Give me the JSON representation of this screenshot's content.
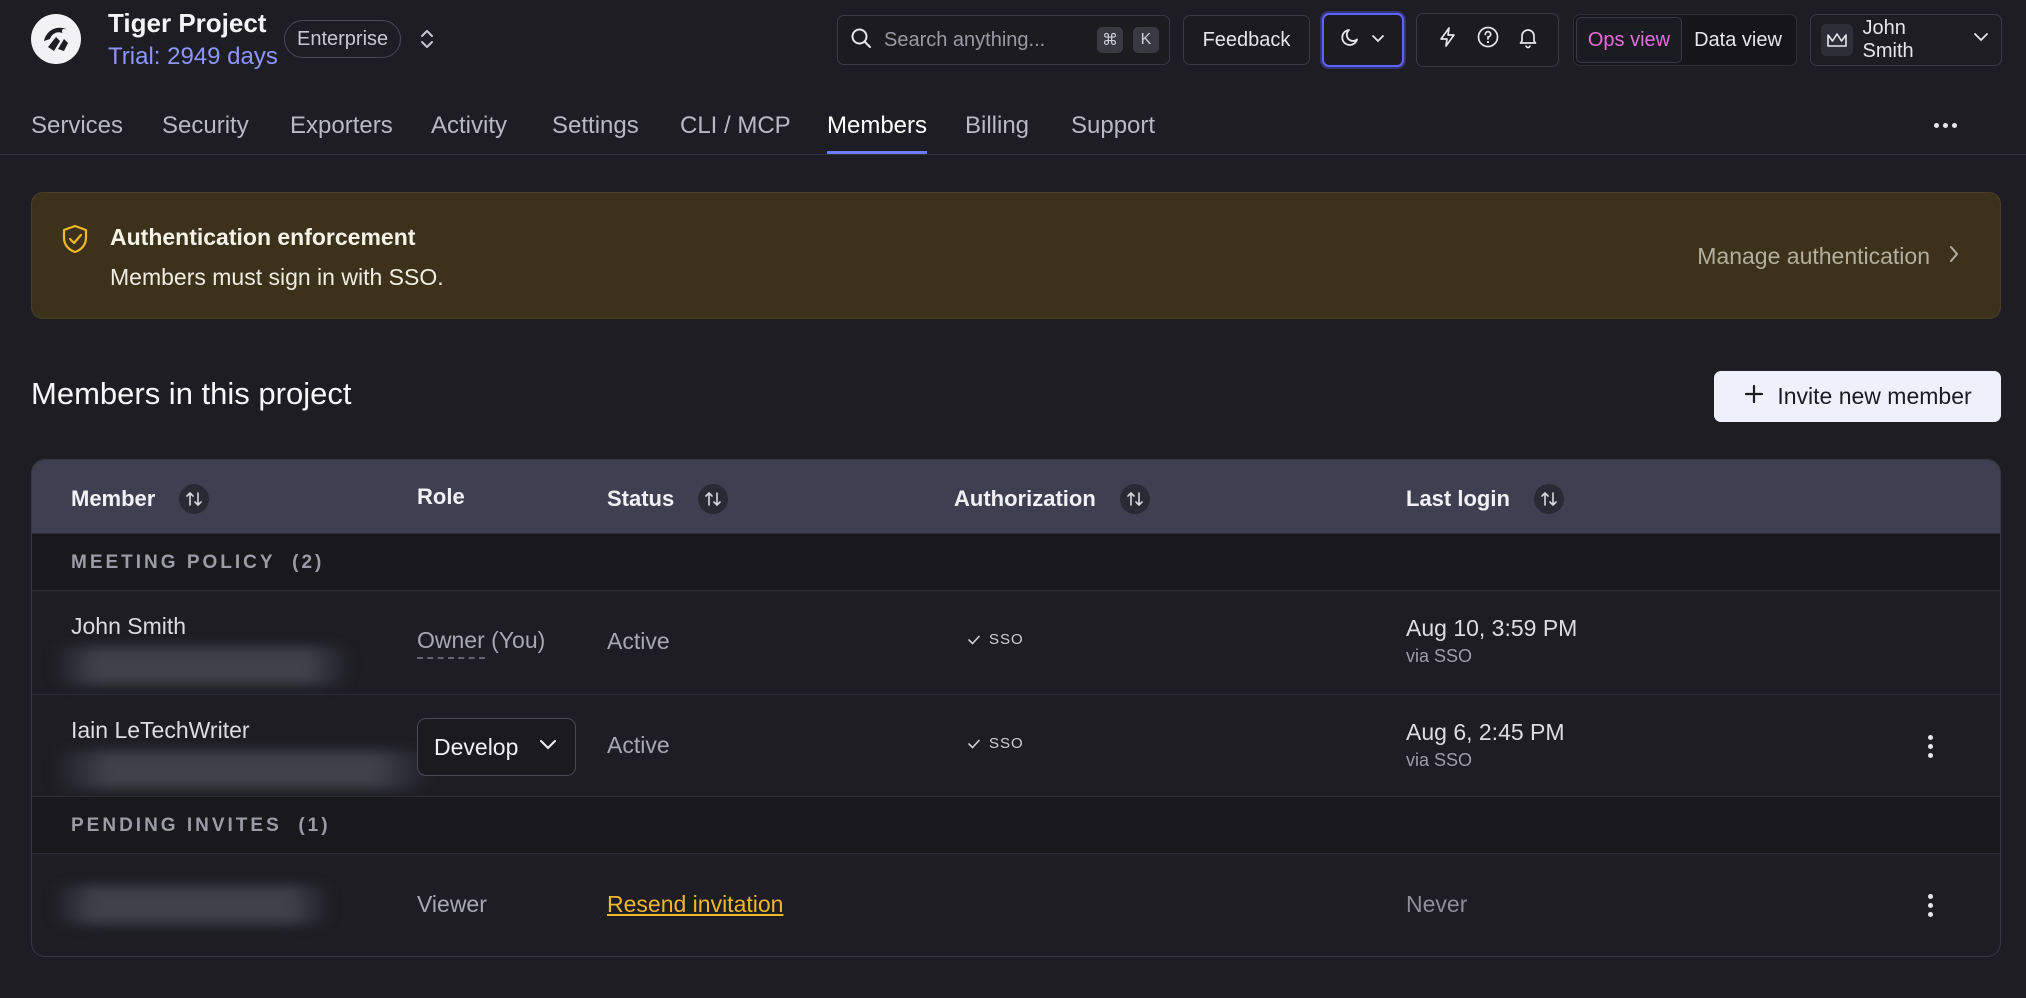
{
  "project": {
    "title": "Tiger Project",
    "trial": "Trial: 2949 days",
    "plan": "Enterprise"
  },
  "search": {
    "placeholder": "Search anything...",
    "kbd_mod": "⌘",
    "kbd_key": "K"
  },
  "toolbar": {
    "feedback_label": "Feedback",
    "view_ops": "Ops view",
    "view_data": "Data view",
    "active_view": "Ops view",
    "user_name": "John Smith"
  },
  "tabs": [
    {
      "label": "Services"
    },
    {
      "label": "Security"
    },
    {
      "label": "Exporters"
    },
    {
      "label": "Activity"
    },
    {
      "label": "Settings"
    },
    {
      "label": "CLI / MCP"
    },
    {
      "label": "Members"
    },
    {
      "label": "Billing"
    },
    {
      "label": "Support"
    }
  ],
  "active_tab": "Members",
  "banner": {
    "title": "Authentication enforcement",
    "text": "Members must sign in with SSO.",
    "link": "Manage authentication"
  },
  "section": {
    "title": "Members in this project",
    "invite_label": "Invite new member"
  },
  "table": {
    "columns": {
      "member": "Member",
      "role": "Role",
      "status": "Status",
      "authorization": "Authorization",
      "last_login": "Last login"
    },
    "groups": [
      {
        "label": "MEETING POLICY",
        "count": "(2)",
        "rows": [
          {
            "name": "John Smith",
            "role": "Owner",
            "role_suffix": "(You)",
            "status": "Active",
            "auth": "SSO",
            "last_login": "Aug 10, 3:59 PM",
            "login_via": "via SSO"
          },
          {
            "name": "Iain LeTechWriter",
            "role": "Develop",
            "status": "Active",
            "auth": "SSO",
            "last_login": "Aug 6, 2:45 PM",
            "login_via": "via SSO"
          }
        ]
      },
      {
        "label": "PENDING INVITES",
        "count": "(1)",
        "rows": [
          {
            "role": "Viewer",
            "status": "Resend invitation",
            "last_login": "Never"
          }
        ]
      }
    ]
  },
  "colors": {
    "background": "#1d1d23",
    "accent": "#6c7cff",
    "trial": "#8c96ff",
    "banner_bg": "#3c321c",
    "warning": "#f0b72a",
    "ops_view": "#e36ddb"
  }
}
